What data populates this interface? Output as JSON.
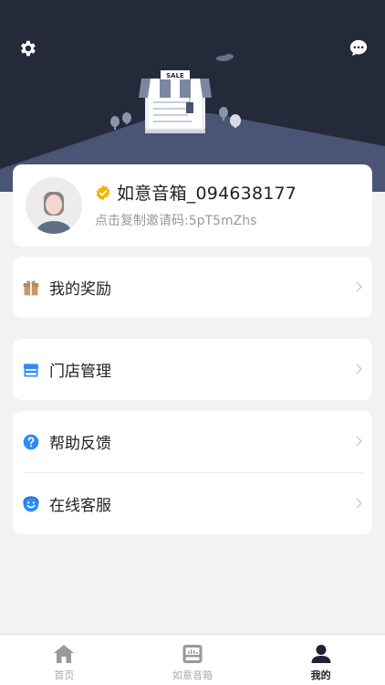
{
  "header": {
    "settings_icon": "gear-icon",
    "message_icon": "chat-bubble-icon",
    "store_sign": "SALE"
  },
  "profile": {
    "username": "如意音箱_094638177",
    "invite_text": "点击复制邀请码:5pT5mZhs",
    "verified_icon": "verified-badge-icon",
    "avatar": "default-avatar"
  },
  "menus": [
    {
      "items": [
        {
          "label": "我的奖励",
          "icon": "gift-icon"
        }
      ]
    },
    {
      "items": [
        {
          "label": "门店管理",
          "icon": "store-icon"
        }
      ]
    },
    {
      "items": [
        {
          "label": "帮助反馈",
          "icon": "help-icon"
        },
        {
          "label": "在线客服",
          "icon": "customer-service-icon"
        }
      ]
    }
  ],
  "tabs": [
    {
      "label": "首页",
      "icon": "home-icon",
      "active": false
    },
    {
      "label": "如意音箱",
      "icon": "speaker-icon",
      "active": false
    },
    {
      "label": "我的",
      "icon": "user-icon",
      "active": true
    }
  ],
  "colors": {
    "header_bg": "#252a3b",
    "hill": "#4a5575",
    "accent_blue": "#2f8bf5",
    "badge_gold": "#f5b400"
  }
}
